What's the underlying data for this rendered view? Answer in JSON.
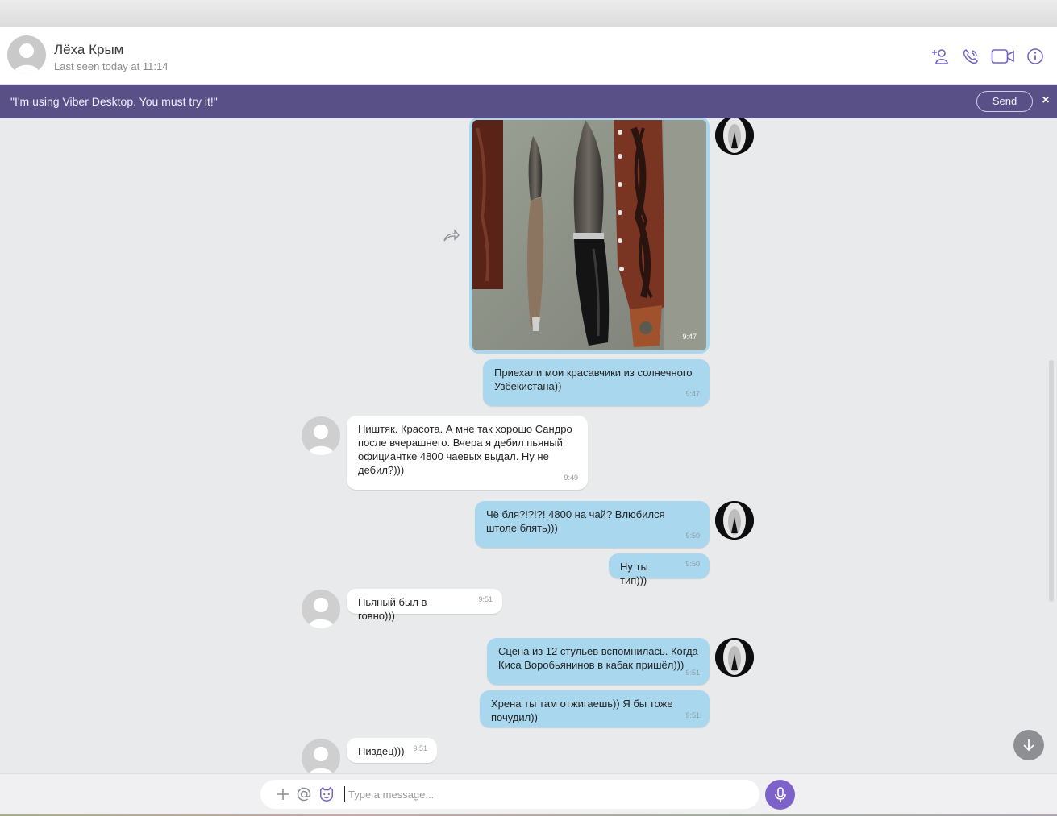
{
  "contact": {
    "name": "Лёха Крым",
    "last_seen": "Last seen today at 11:14"
  },
  "header_icons": [
    "add-contact-icon",
    "call-icon",
    "video-call-icon",
    "info-icon"
  ],
  "banner": {
    "text": "\"I'm using Viber Desktop. You must try it!\"",
    "send_label": "Send",
    "close_label": "×"
  },
  "messages": [
    {
      "dir": "out",
      "kind": "photo",
      "time": "9:47"
    },
    {
      "dir": "out",
      "text": "Приехали мои красавчики из солнечного Узбекистана))",
      "time": "9:47"
    },
    {
      "dir": "in",
      "text": "Ништяк. Красота. А мне так хорошо Сандро после вчерашнего. Вчера я дебил пьяный официантке 4800 чаевых выдал. Ну не дебил?)))",
      "time": "9:49"
    },
    {
      "dir": "out",
      "text": "Чё бля?!?!?! 4800 на чай? Влюбился штоле блять)))",
      "time": "9:50"
    },
    {
      "dir": "out",
      "text": "Ну ты тип)))",
      "time": "9:50"
    },
    {
      "dir": "in",
      "text": "Пьяный был в говно)))",
      "time": "9:51"
    },
    {
      "dir": "out",
      "text": "Сцена из 12 стульев вспомнилась. Когда Киса Воробьянинов в кабак пришёл)))",
      "time": "9:51"
    },
    {
      "dir": "out",
      "text": "Хрена ты там отжигаешь)) Я бы тоже почудил))",
      "time": "9:51"
    },
    {
      "dir": "in",
      "text": "Пиздец)))",
      "time": "9:51"
    }
  ],
  "composer": {
    "placeholder": "Type a message...",
    "icons": [
      "plus-icon",
      "at-icon",
      "sticker-icon",
      "microphone-icon"
    ]
  }
}
